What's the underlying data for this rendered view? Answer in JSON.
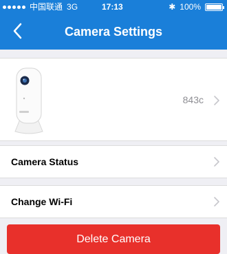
{
  "status_bar": {
    "carrier": "中国联通",
    "network": "3G",
    "time": "17:13",
    "battery": "100%"
  },
  "nav": {
    "title": "Camera Settings",
    "back_icon": "chevron-left-icon"
  },
  "device": {
    "name": "843c",
    "image": "camera-icon"
  },
  "rows": [
    {
      "label": "Camera Status"
    },
    {
      "label": "Change Wi-Fi"
    }
  ],
  "delete_button": {
    "label": "Delete Camera"
  },
  "colors": {
    "header": "#1a7fd9",
    "delete": "#e8302b",
    "background": "#efeff4"
  }
}
